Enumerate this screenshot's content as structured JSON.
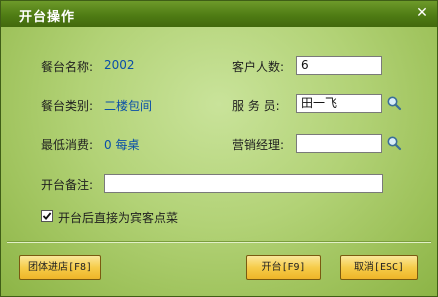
{
  "window": {
    "title": "开台操作"
  },
  "form": {
    "table_name_label": "餐台名称:",
    "table_name_value": "2002",
    "table_type_label": "餐台类别:",
    "table_type_value": "二楼包间",
    "min_spend_label": "最低消费:",
    "min_spend_value": "0 每桌",
    "guests_label": "客户人数:",
    "guests_value": "6",
    "waiter_label": "服 务 员:",
    "waiter_value": "田一飞",
    "sales_manager_label": "营销经理:",
    "sales_manager_value": "",
    "remark_label": "开台备注:",
    "remark_value": "",
    "order_checkbox_label": "开台后直接为宾客点菜",
    "order_checkbox_checked": true
  },
  "buttons": {
    "group_checkin": "团体进店[F8]",
    "open_table": "开台[F9]",
    "cancel": "取消[ESC]"
  },
  "icons": {
    "search": "magnifier-icon",
    "close": "close-icon",
    "check": "check-icon"
  }
}
